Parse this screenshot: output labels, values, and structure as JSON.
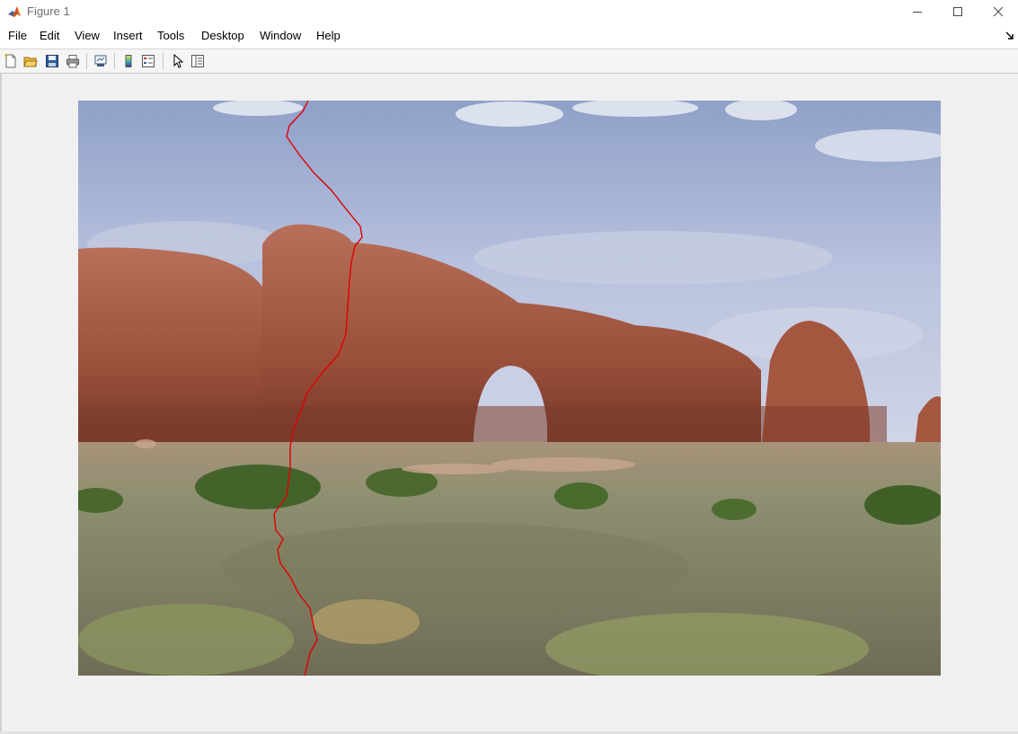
{
  "window": {
    "title": "Figure 1",
    "icon": "matlab-icon",
    "controls": [
      "minimize-icon",
      "maximize-icon",
      "close-icon"
    ]
  },
  "menubar": {
    "items": [
      {
        "label": "File"
      },
      {
        "label": "Edit"
      },
      {
        "label": "View"
      },
      {
        "label": "Insert"
      },
      {
        "label": "Tools"
      },
      {
        "label": "Desktop"
      },
      {
        "label": "Window"
      },
      {
        "label": "Help"
      }
    ],
    "dock_icon": "dock-arrow-icon"
  },
  "toolbar": {
    "buttons": [
      {
        "icon": "new-figure-icon"
      },
      {
        "icon": "open-file-icon"
      },
      {
        "icon": "save-icon"
      },
      {
        "icon": "print-icon"
      },
      {
        "icon": "link-plot-icon"
      },
      {
        "icon": "insert-colorbar-icon"
      },
      {
        "icon": "insert-legend-icon"
      },
      {
        "icon": "edit-plot-pointer-icon"
      },
      {
        "icon": "property-inspector-icon"
      }
    ]
  },
  "figure": {
    "content": "photo of red sandstone arch under cloudy sky with desert shrubland, overlaid with a red seam line",
    "seam_color": "#e00000"
  }
}
